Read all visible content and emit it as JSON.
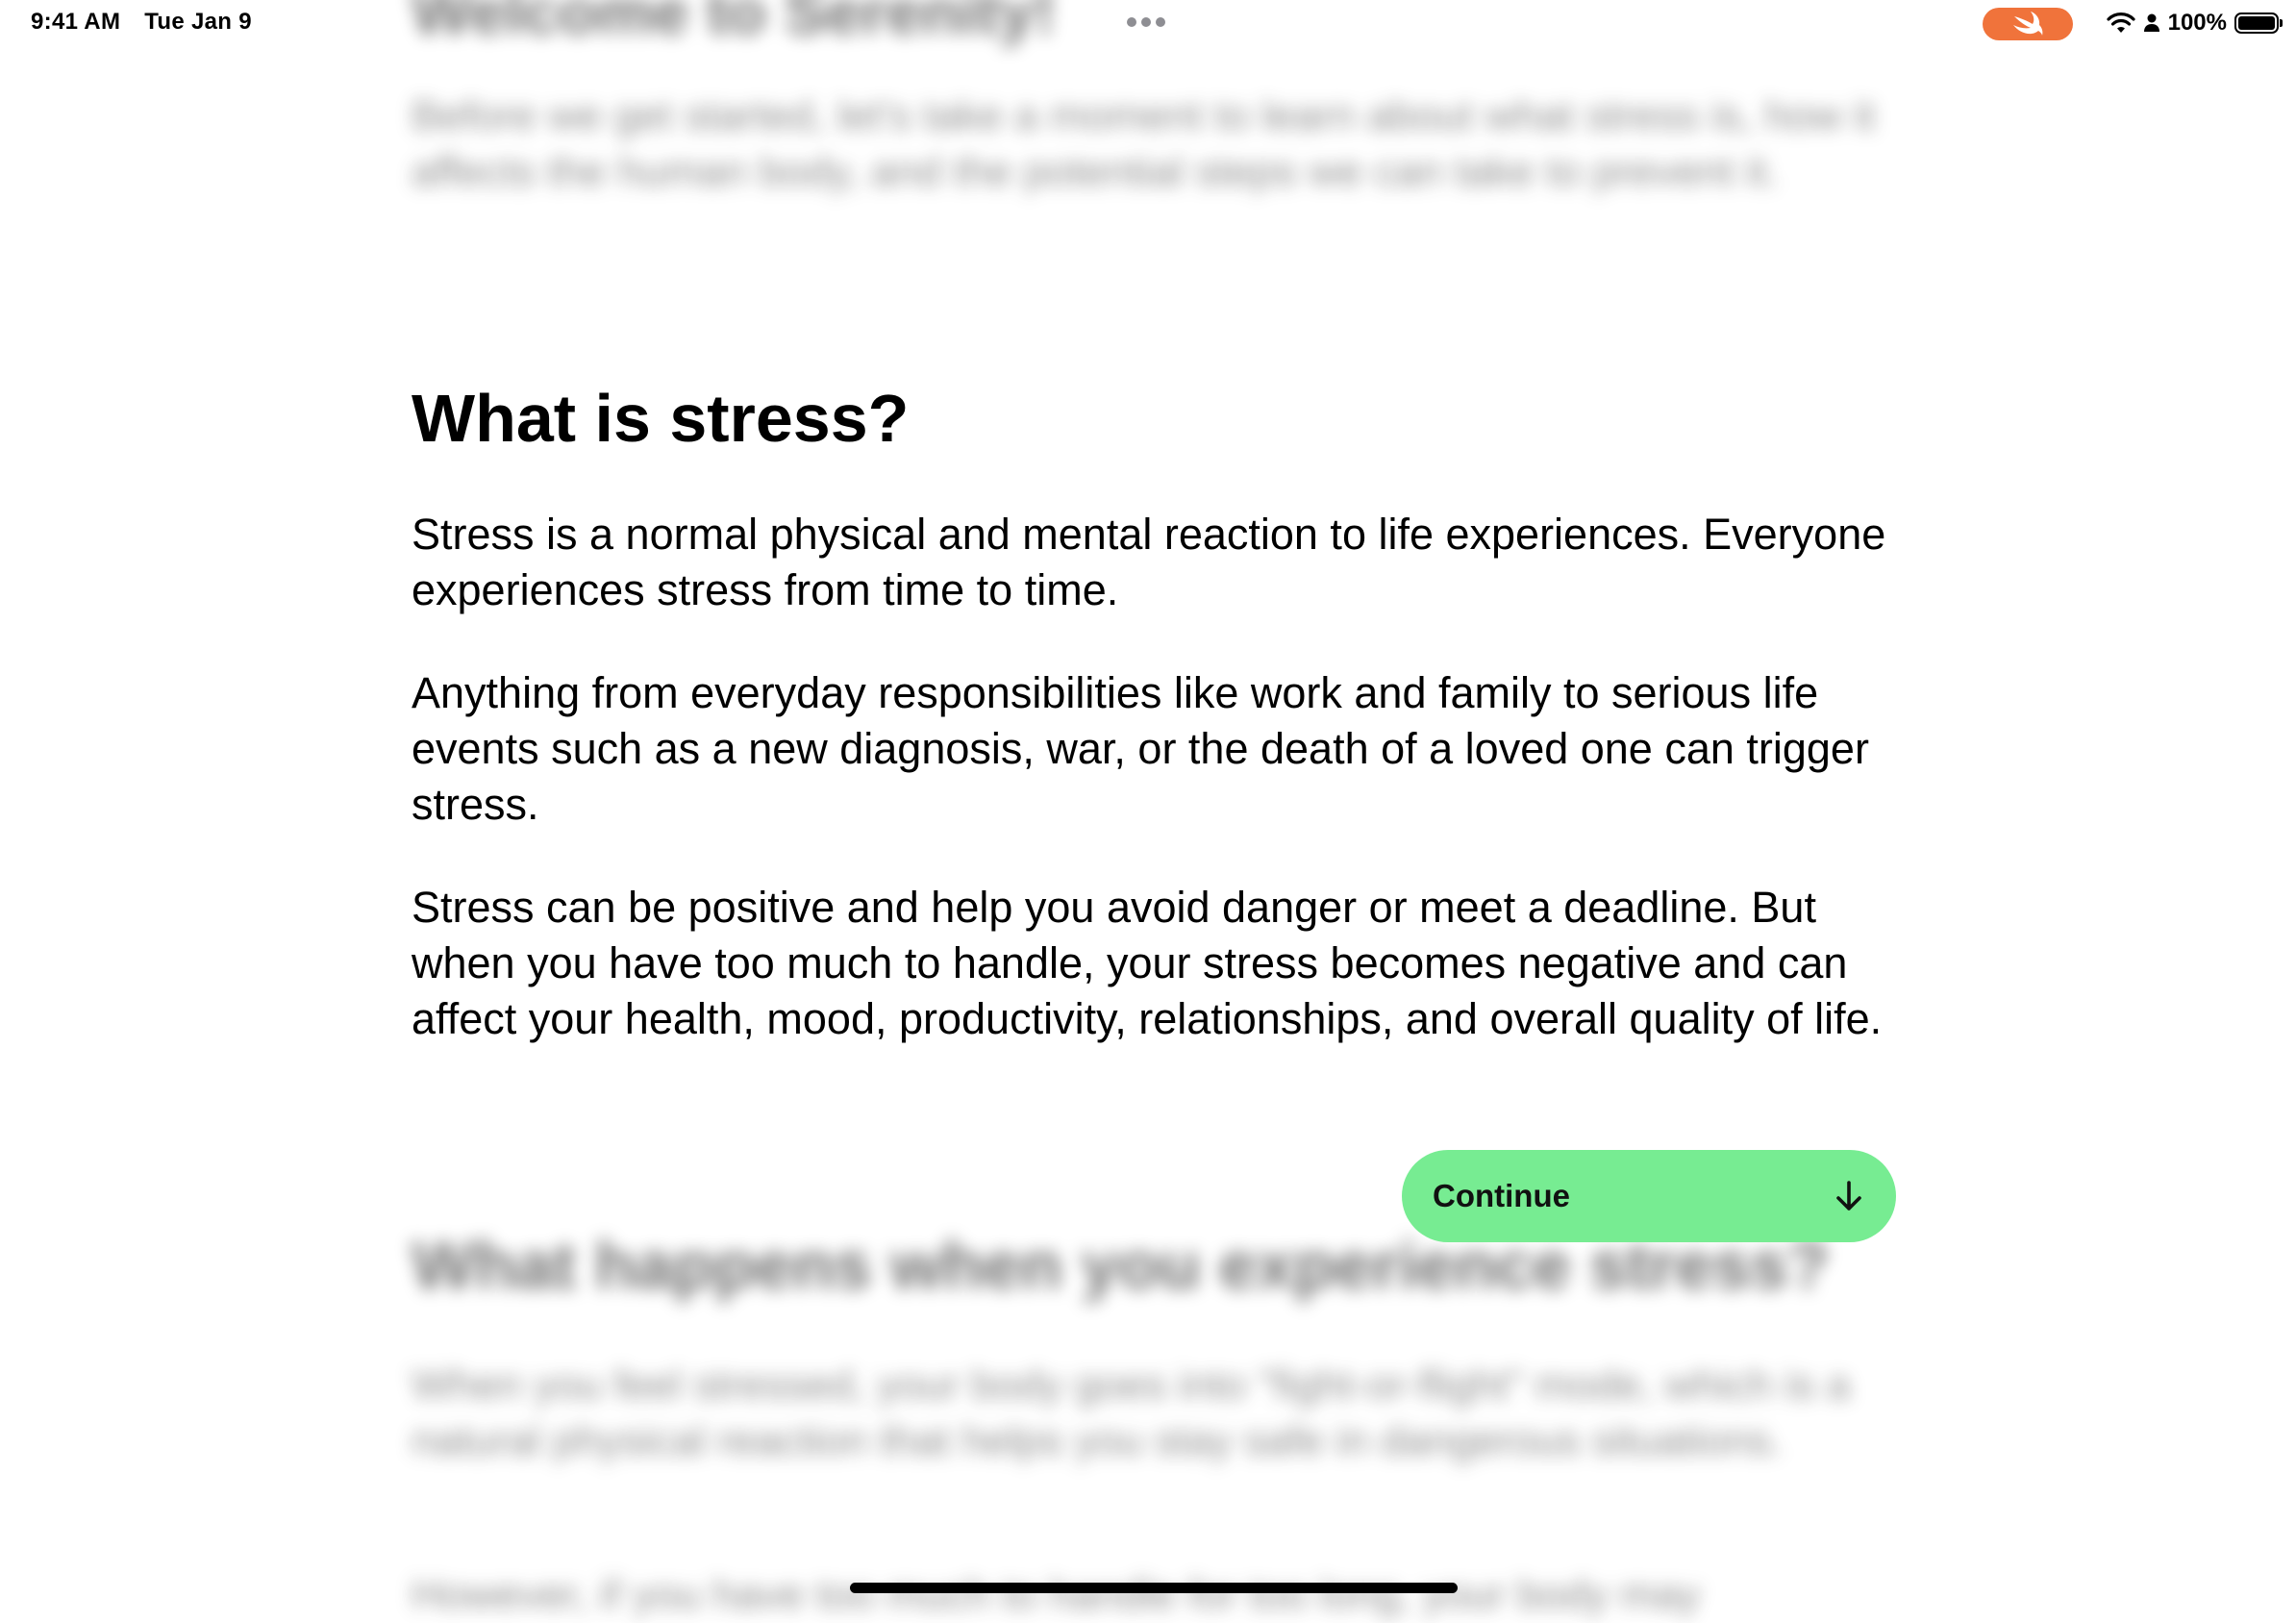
{
  "status_bar": {
    "time": "9:41 AM",
    "date": "Tue Jan 9",
    "battery_percent": "100%",
    "battery_level": 1.0,
    "swift_pill_color": "#f0733b"
  },
  "previous_section": {
    "title": "Welcome to Serenity!",
    "text": "Before we get started, let's take a moment to learn about what stress is, how it affects the human body, and the potential steps we can take to prevent it."
  },
  "current_section": {
    "title": "What is stress?",
    "paragraphs": [
      "Stress is a normal physical and mental reaction to life experiences. Everyone experiences stress from time to time.",
      "Anything from everyday responsibilities like work and family to serious life events such as a new diagnosis, war, or the death of a loved one can trigger stress.",
      "Stress can be positive and help you avoid danger or meet a deadline. But when you have too much to handle, your stress becomes negative and can affect your health, mood, productivity, relationships, and overall quality of life."
    ]
  },
  "continue_button": {
    "label": "Continue",
    "icon": "arrow-down-icon",
    "color": "#77ec92"
  },
  "next_section": {
    "title": "What happens when you experience stress?",
    "paragraphs": [
      "When you feel stressed, your body goes into \"fight-or-flight\" mode, which is a natural physical reaction that helps you stay safe in dangerous situations.",
      "However, if you have too much to handle for too long, your body may"
    ]
  }
}
